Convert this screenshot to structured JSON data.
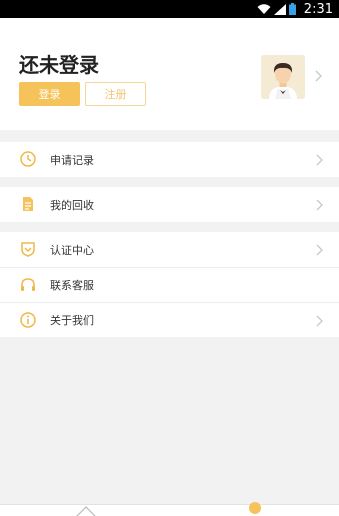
{
  "status_bar": {
    "time": "2:31"
  },
  "profile": {
    "title": "还未登录",
    "login_label": "登录",
    "register_label": "注册"
  },
  "menu": {
    "group1": [
      {
        "label": "申请记录",
        "icon": "clock-icon"
      }
    ],
    "group2": [
      {
        "label": "我的回收",
        "icon": "document-icon"
      }
    ],
    "group3": [
      {
        "label": "认证中心",
        "icon": "shield-icon"
      },
      {
        "label": "联系客服",
        "icon": "headset-icon"
      },
      {
        "label": "关于我们",
        "icon": "info-icon"
      }
    ]
  },
  "colors": {
    "accent": "#f6c35a",
    "accent_border": "#f4d69a",
    "background": "#f2f2f2"
  }
}
